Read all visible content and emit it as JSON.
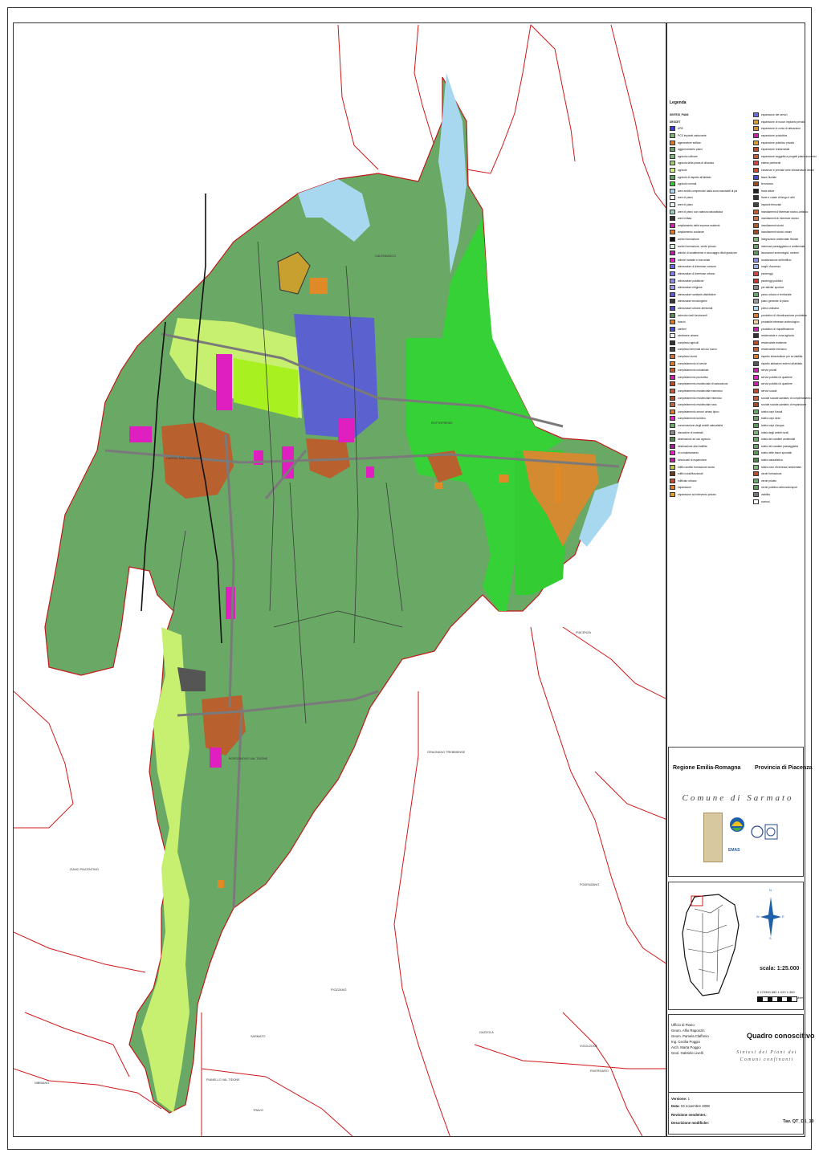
{
  "legend": {
    "title": "Legenda",
    "left": [
      {
        "label": "SINTESI_PIANI",
        "color": "",
        "header": true
      },
      {
        "label": "DESCET",
        "color": "",
        "header": true
      },
      {
        "label": "ARE",
        "color": "#3b3bdb"
      },
      {
        "label": "PCS impianti carburante",
        "color": "#7fb06c"
      },
      {
        "label": "ageneratore edilizie",
        "color": "#e07a27"
      },
      {
        "label": "aggiornamento piano",
        "color": "#6aa06a"
      },
      {
        "label": "agricola collinare",
        "color": "#7ab878"
      },
      {
        "label": "agricola della piana di divanisa",
        "color": "#9fd06c"
      },
      {
        "label": "agricole",
        "color": "#c8f07a"
      },
      {
        "label": "agricole di rispetto all'abitato",
        "color": "#5fa35f"
      },
      {
        "label": "agricole normali",
        "color": "#33cc33"
      },
      {
        "label": "aree ambiti comprensivi dalla zona mandabili di pienamente dal Piru e dal Tidone",
        "color": "#a8d8f0"
      },
      {
        "label": "aree di pieno",
        "color": "#ffffff"
      },
      {
        "label": "aree di piano",
        "color": "#e8f8e8"
      },
      {
        "label": "aree di pieno con valenza naturalistica",
        "color": "#9ad0c0"
      },
      {
        "label": "aree iniritaa",
        "color": "#333333"
      },
      {
        "label": "ampliamento delle imprese esistenti",
        "color": "#d21fb0"
      },
      {
        "label": "ampliamento sostanze",
        "color": "#e07a27"
      },
      {
        "label": "archivi formazione",
        "color": "#111111"
      },
      {
        "label": "archivi formazione, verde privato",
        "color": "#d8f0d8"
      },
      {
        "label": "attivita' di smaltimento e stoccaggio rifiuti giada teneo ambiente",
        "color": "#b81fa0"
      },
      {
        "label": "attivita' barbale e borroviale",
        "color": "#e81fc8"
      },
      {
        "label": "attrezzature di interesse comune",
        "color": "#6a6ae8"
      },
      {
        "label": "attrezzature di interesse urbano",
        "color": "#7a7ae8"
      },
      {
        "label": "attrezzature pubbliche",
        "color": "#8a8ae8"
      },
      {
        "label": "attrezzature religiose",
        "color": "#9a9ae8"
      },
      {
        "label": "attrezzature sanitarie-distributive",
        "color": "#5a5ad8"
      },
      {
        "label": "attrezzature tecnologiche",
        "color": "#3a3a3a"
      },
      {
        "label": "attrezzature urbane-territoriali",
        "color": "#4a4ac8"
      },
      {
        "label": "azienda rurali funzionanti",
        "color": "#5a8a5a"
      },
      {
        "label": "boschi",
        "color": "#e07a27"
      },
      {
        "label": "cantieri",
        "color": "#4a4ad8"
      },
      {
        "label": "centriaree urbane",
        "color": "#f0f0f0"
      },
      {
        "label": "complessi agricoli",
        "color": "#333333"
      },
      {
        "label": "complessi terminali ad uso nuovo",
        "color": "#444444"
      },
      {
        "label": "complessi storici",
        "color": "#d07040"
      },
      {
        "label": "completamento di servizi",
        "color": "#e07a27"
      },
      {
        "label": "completamento industriale",
        "color": "#c85a27"
      },
      {
        "label": "completamento produttivo",
        "color": "#d21fb0"
      },
      {
        "label": "completamento residenziale di saturazione",
        "color": "#c04a27"
      },
      {
        "label": "completamento residenziale estensivo",
        "color": "#c85a37"
      },
      {
        "label": "completamento residenziale intensivo",
        "color": "#a84a27"
      },
      {
        "label": "completamento residenziale rado",
        "color": "#b86a47"
      },
      {
        "label": "completamento servizi urbani tipico",
        "color": "#e07a27"
      },
      {
        "label": "completamento turistico",
        "color": "#e81fc8"
      },
      {
        "label": "conservazione degli ambiti naturalistici",
        "color": "#66aa66"
      },
      {
        "label": "discariche di materiali",
        "color": "#888888"
      },
      {
        "label": "destinazioni ad uso agricolo",
        "color": "#4a8a4a"
      },
      {
        "label": "destinazione alla viabilita",
        "color": "#a02090"
      },
      {
        "label": "di completamento",
        "color": "#e81fc8"
      },
      {
        "label": "direzionali di espansione",
        "color": "#b81fa0"
      },
      {
        "label": "edifici ambito formazione storici",
        "color": "#c0c040"
      },
      {
        "label": "edifici rurali/funzionali",
        "color": "#6a3a1a"
      },
      {
        "label": "edificato urbano",
        "color": "#c04a27"
      },
      {
        "label": "espansione",
        "color": "#e07a27"
      },
      {
        "label": "espansione ad intervento privato",
        "color": "#e0a027"
      }
    ],
    "right": [
      {
        "label": "espansione dei servizi",
        "color": "#6a6ae8"
      },
      {
        "label": "espansione di nuovo impianto privato",
        "color": "#e0a027"
      },
      {
        "label": "espansione in corso di attuazione",
        "color": "#d0902a"
      },
      {
        "label": "espansione produttiva",
        "color": "#d21fb0"
      },
      {
        "label": "espansione pubblico privata",
        "color": "#e0a027"
      },
      {
        "label": "espansione residenziale",
        "color": "#c04a27"
      },
      {
        "label": "espansione soggetta a progetti planivolumetrici",
        "color": "#c85a37"
      },
      {
        "label": "estese pertinenti",
        "color": "#e04040"
      },
      {
        "label": "esistenze e previste aree infrastrutture lineari",
        "color": "#d84a27"
      },
      {
        "label": "fasce fluviale",
        "color": "#4a4ad8"
      },
      {
        "label": "ferroviaria",
        "color": "#a04a1a"
      },
      {
        "label": "frane attive",
        "color": "#222222"
      },
      {
        "label": "frane e colate di fango e altri",
        "color": "#333333"
      },
      {
        "label": "impianti ferroviari",
        "color": "#444444"
      },
      {
        "label": "insediamenti d'interesse storico-artistico",
        "color": "#c85a27"
      },
      {
        "label": "insediamenti di interesse storico",
        "color": "#d07040"
      },
      {
        "label": "insediamenti storici",
        "color": "#b85a27"
      },
      {
        "label": "insediamenti storici urbani",
        "color": "#a84a27"
      },
      {
        "label": "integrazione ambientale fluviale",
        "color": "#7ab878"
      },
      {
        "label": "interesse paesaggistico e ambientale",
        "color": "#6aa06a"
      },
      {
        "label": "lavorazioni archeologici, sentieri",
        "color": "#5a9a5a"
      },
      {
        "label": "localizzazione dell'edificio",
        "color": "#8a8ae8"
      },
      {
        "label": "luoghi d'accesso",
        "color": "#9ab0e8"
      },
      {
        "label": "parcheggi",
        "color": "#e04040"
      },
      {
        "label": "parcheggi pubblici",
        "color": "#d03030"
      },
      {
        "label": "per attivita' sportive",
        "color": "#888888"
      },
      {
        "label": "parco urbano e territoriale",
        "color": "#66aa66"
      },
      {
        "label": "piano generale di piano",
        "color": "#999999"
      },
      {
        "label": "piena ordinaria",
        "color": "#a8d8f0"
      },
      {
        "label": "produttivo di rilocalizzazione produttiva",
        "color": "#e07a27"
      },
      {
        "label": "probabile interesse archeologico",
        "color": "#f0d0a0"
      },
      {
        "label": "produttivo di riqualificazione",
        "color": "#d21fb0"
      },
      {
        "label": "residenziale e zona agricola",
        "color": "#333333"
      },
      {
        "label": "residenziale esistente",
        "color": "#c04a27"
      },
      {
        "label": "residenziale intensivo",
        "color": "#c85a37"
      },
      {
        "label": "rispetto infrastrutture per la viabilita",
        "color": "#e07a27"
      },
      {
        "label": "rispetto abitazioni esterni all'abitato",
        "color": "#555555"
      },
      {
        "label": "servizi privati",
        "color": "#d21fb0"
      },
      {
        "label": "servizi pubblici di quartiere",
        "color": "#e81fc8"
      },
      {
        "label": "servizi pubblici di quartiere",
        "color": "#d21fb0"
      },
      {
        "label": "servizi sociali",
        "color": "#c04a27"
      },
      {
        "label": "sociale sociale-sanitario di completamento",
        "color": "#c85a37"
      },
      {
        "label": "sociale sociale-sanitario di espansione",
        "color": "#a84a27"
      },
      {
        "label": "tutela corpi fluviali",
        "color": "#66aa66"
      },
      {
        "label": "tutela corpi idrici",
        "color": "#6aa06a"
      },
      {
        "label": "tutela corpi d'acqua",
        "color": "#5a9a5a"
      },
      {
        "label": "tutela degli ambiti rurali",
        "color": "#7ab878"
      },
      {
        "label": "tutela dei caratteri ambientali",
        "color": "#66aa66"
      },
      {
        "label": "tutela dei caratteri paesaggistici",
        "color": "#6aa06a"
      },
      {
        "label": "tutela delle fasce spondali",
        "color": "#5a9a5a"
      },
      {
        "label": "tutela naturalistica",
        "color": "#4a8a4a"
      },
      {
        "label": "tutela zone d'interesse ambientale",
        "color": "#7ab878"
      },
      {
        "label": "verde formazione",
        "color": "#c04a27"
      },
      {
        "label": "verde privato",
        "color": "#66aa66"
      },
      {
        "label": "verde pubblico attrezzato/sport",
        "color": "#5a9a5a"
      },
      {
        "label": "viabilita",
        "color": "#777777"
      },
      {
        "label": "comuni",
        "color": "#ffffff"
      }
    ]
  },
  "places": {
    "calendasco": "CALENDASCO",
    "piacenza": "PIACENZA",
    "rottofreno": "ROTTOFRENO",
    "gragnano": "GRAGNANO TREBBIENSE",
    "borgonovo": "BORGONOVO VAL TIDONE",
    "castelsangiovanni": "CASTEL SAN GIOVANNI",
    "ziano": "ZIANO PIACENTINO",
    "podenzano": "PODENZANO",
    "vigolzone": "VIGOLZONE",
    "piozzano": "PIOZZANO",
    "gazzola": "GAZZOLA",
    "pianello": "PIANELLO VAL TIDONE",
    "travo": "TRAVO",
    "rivergaro": "RIVERGARO",
    "nibbiano": "NIBBIANO",
    "sarmato": "SARMATO"
  },
  "title_block": {
    "region": "Regione Emilia-Romagna",
    "province": "Provincia di Piacenza",
    "comune": "Comune di Sarmato",
    "emas": "EMAS"
  },
  "scale": {
    "label": "scala:   1:25.000",
    "ticks": "0  170340    680    1.020   1.360",
    "unit": "Metri"
  },
  "credits": {
    "ufficio": "Ufficio di Piano:",
    "names": [
      "Geom. Alfio Raponzin",
      "Geom. Pamela Claffonio",
      "Ing. Cecilia Poggio",
      "Arch. Marta Poggio",
      "Geol. Gabriele Livelli"
    ]
  },
  "doc": {
    "title": "Quadro conoscitivo",
    "subtitle": "Sintesi dei Piani dei Comuni confinanti",
    "versione_label": "Versione:",
    "versione": "1",
    "data_label": "Data:",
    "data": "04 novembre 2008",
    "revisione_label": "Revisione nendenter.:",
    "descrizione_label": "Descrizione modifiche:",
    "code": "Tav. QT_D1_10"
  },
  "compass": {
    "n": "N",
    "e": "E",
    "s": "S",
    "w": "W"
  }
}
